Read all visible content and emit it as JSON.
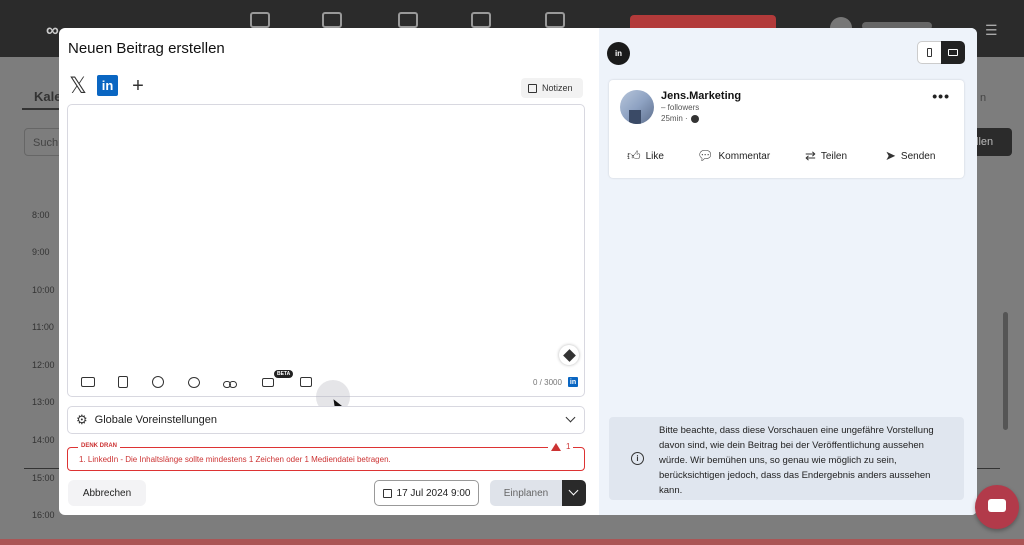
{
  "background": {
    "tab_label": "Kale",
    "search_label": "Such",
    "create_label": "llen",
    "month_label": "n",
    "times": [
      "8:00",
      "9:00",
      "10:00",
      "11:00",
      "12:00",
      "13:00",
      "14:00",
      "15:00",
      "16:00"
    ]
  },
  "modal": {
    "title": "Neuen Beitrag erstellen",
    "networks": {
      "x_icon": "𝕏",
      "linkedin_icon": "in",
      "add_icon": "+"
    },
    "notes_label": "Notizen",
    "editor": {
      "beta_badge": "BETA",
      "counter": "0 / 3000",
      "counter_icon": "in"
    },
    "presets_label": "Globale Voreinstellungen",
    "warning": {
      "label": "DENK DRAN",
      "count": "1",
      "text": "1. LinkedIn - Die Inhaltslänge sollte mindestens 1 Zeichen oder 1 Mediendatei betragen."
    },
    "cancel_label": "Abbrechen",
    "date_label": "17 Jul 2024 9:00",
    "schedule_label": "Einplanen"
  },
  "preview": {
    "network_icon": "in",
    "post": {
      "author": "Jens.Marketing",
      "followers": "– followers",
      "time": "25min ·",
      "actions": {
        "like": "Like",
        "comment": "Kommentar",
        "share": "Teilen",
        "send": "Senden"
      }
    },
    "notice": "Bitte beachte, dass diese Vorschauen eine ungefähre Vorstellung davon sind, wie dein Beitrag bei der Veröffentlichung aussehen würde. Wir bemühen uns, so genau wie möglich zu sein, berücksichtigen jedoch, dass das Endergebnis anders aussehen kann.",
    "info_icon": "i"
  },
  "colors": {
    "accent_red": "#cc3333",
    "linkedin_blue": "#0a66c2",
    "chat_fab": "#b23a4a"
  }
}
